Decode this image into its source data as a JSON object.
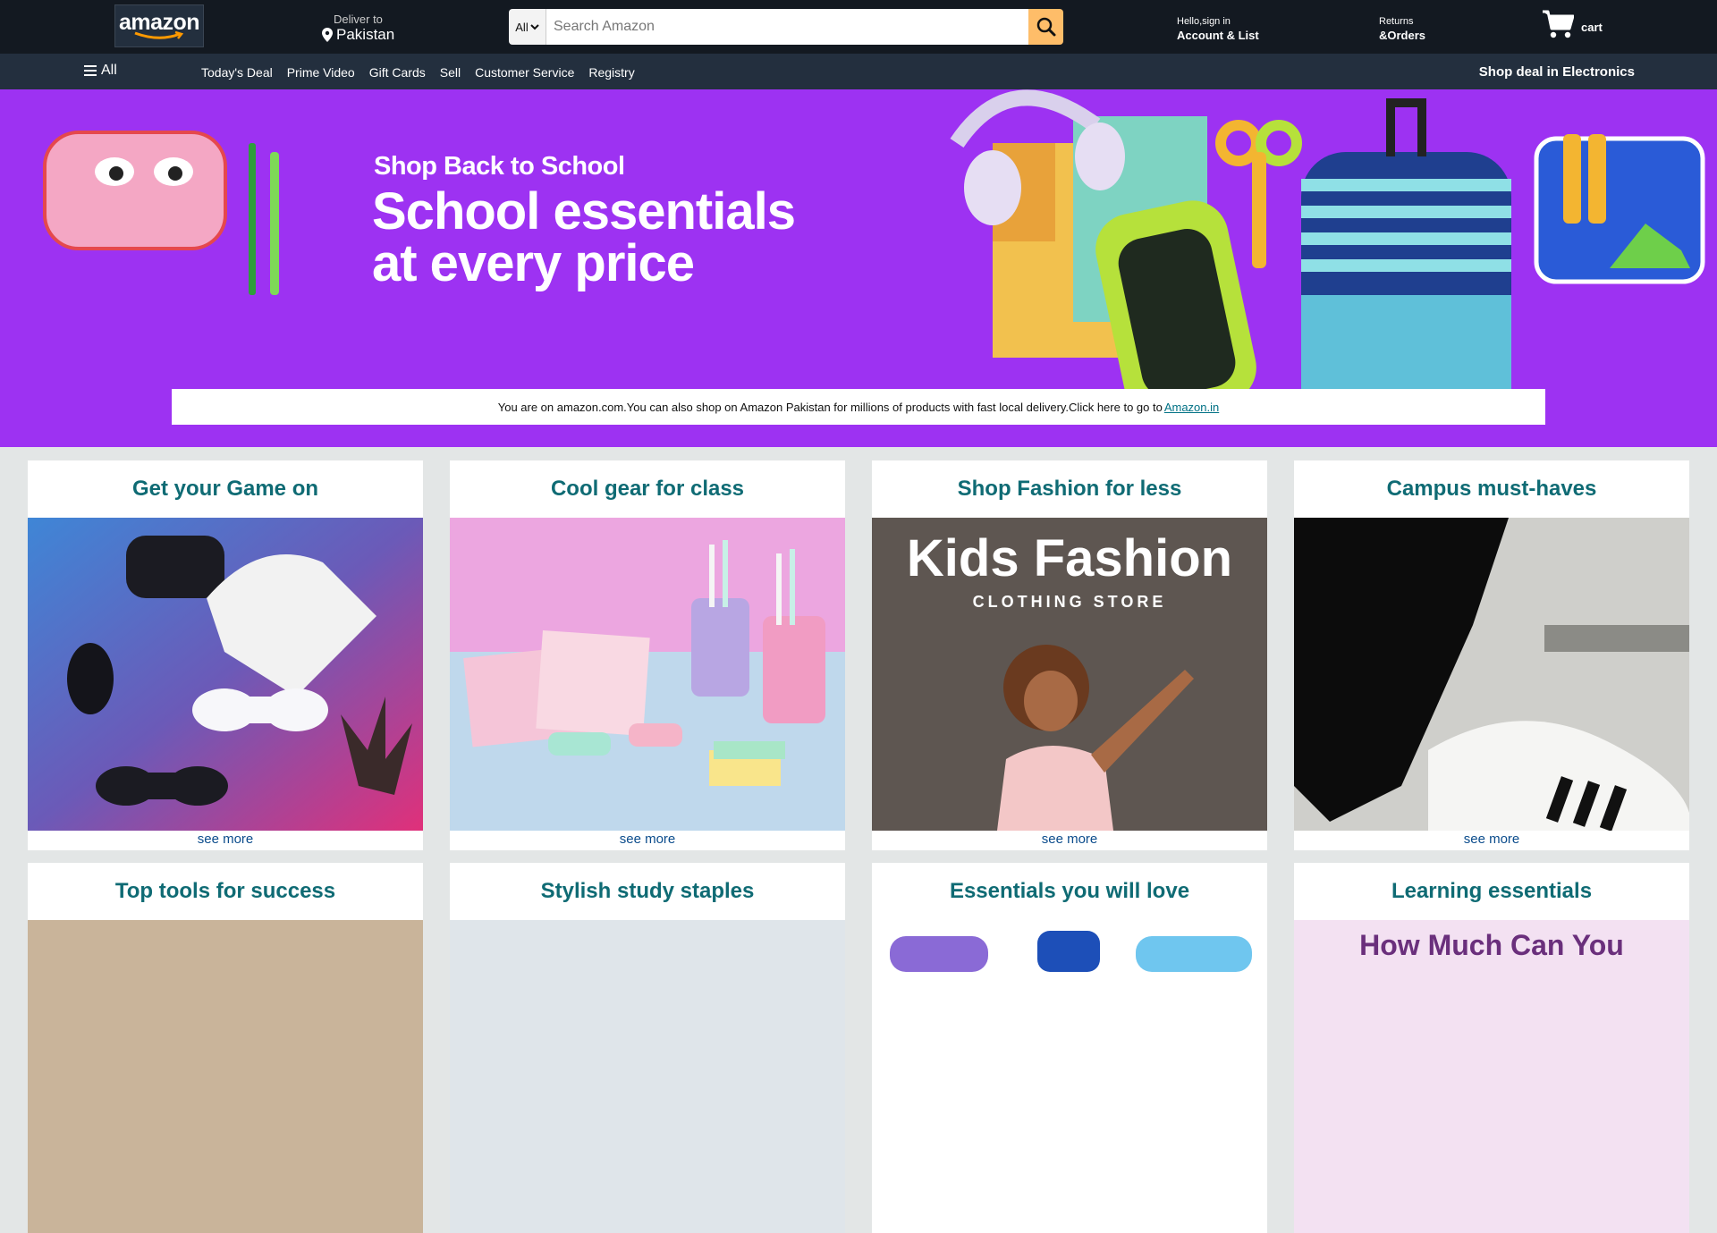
{
  "header": {
    "logo_text": "amazon",
    "deliver_small": "Deliver to",
    "deliver_location": "Pakistan",
    "search_category": "All",
    "search_placeholder": "Search Amazon",
    "account_small": "Hello,sign in",
    "account_bold": "Account & List",
    "returns_small": "Returns",
    "returns_bold": "&Orders",
    "cart_label": "cart"
  },
  "subnav": {
    "all_label": "All",
    "links": [
      "Today's Deal",
      "Prime Video",
      "Gift Cards",
      "Sell",
      "Customer Service",
      "Registry"
    ],
    "right_label": "Shop deal in Electronics"
  },
  "hero": {
    "kicker": "Shop Back to School",
    "title_line1": "School essentials",
    "title_line2": "at every price",
    "notice_text": "You are on amazon.com.You can also shop on Amazon Pakistan for millions of products with fast local delivery.Click here to go to",
    "notice_link": "Amazon.in"
  },
  "cards": [
    {
      "title": "Get your Game on",
      "more": "see more"
    },
    {
      "title": "Cool gear for class",
      "more": "see more"
    },
    {
      "title": "Shop Fashion for less",
      "more": "see more",
      "img_title": "Kids Fashion",
      "img_subtitle": "CLOTHING STORE"
    },
    {
      "title": "Campus must-haves",
      "more": "see more"
    },
    {
      "title": "Top tools for success"
    },
    {
      "title": "Stylish study staples"
    },
    {
      "title": "Essentials you will love"
    },
    {
      "title": "Learning essentials",
      "img_text": "How Much Can You"
    }
  ],
  "colors": {
    "nav_bg": "#131921",
    "subnav_bg": "#232f3e",
    "hero_bg": "#9d32f2",
    "search_button": "#febd69",
    "card_title": "#0f6b74"
  }
}
